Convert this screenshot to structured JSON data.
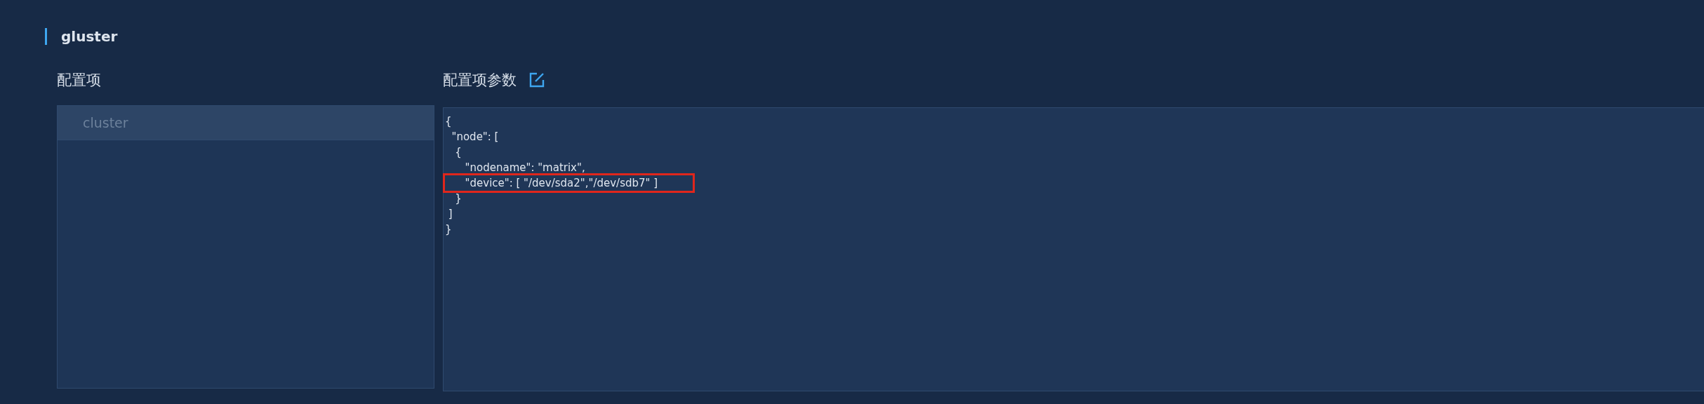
{
  "section": {
    "title": "gluster"
  },
  "config_items": {
    "label": "配置项",
    "items": [
      {
        "name": "cluster",
        "selected": true
      }
    ]
  },
  "config_params": {
    "label": "配置项参数",
    "code_lines": [
      {
        "text": "{",
        "highlighted": false
      },
      {
        "text": "  \"node\": [",
        "highlighted": false
      },
      {
        "text": "   {",
        "highlighted": false
      },
      {
        "text": "      \"nodename\": \"matrix\",",
        "highlighted": false
      },
      {
        "text": "      \"device\": [ \"/dev/sda2\",\"/dev/sdb7\" ]",
        "highlighted": true
      },
      {
        "text": "   }",
        "highlighted": false
      },
      {
        "text": " ]",
        "highlighted": false
      },
      {
        "text": "}",
        "highlighted": false
      }
    ]
  }
}
